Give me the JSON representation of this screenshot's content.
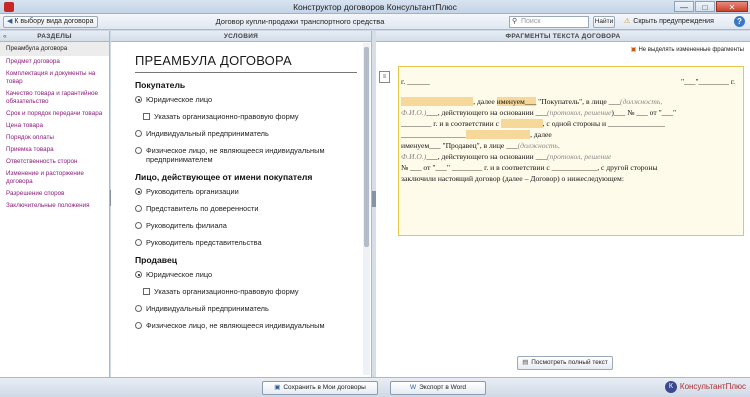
{
  "window": {
    "title": "Конструктор договоров КонсультантПлюс",
    "minimize": "—",
    "maximize": "□",
    "close": "✕"
  },
  "toolbar": {
    "back_label": "К выбору вида договора",
    "doc_title": "Договор купли-продажи транспортного средства",
    "search_placeholder": "Поиск",
    "find_label": "Найти",
    "hide_warnings_label": "Скрыть предупреждения",
    "help": "?"
  },
  "left_panel": {
    "header": "РАЗДЕЛЫ",
    "items": [
      "Преамбула договора",
      "Предмет договора",
      "Комплектация и документы на товар",
      "Качество товара и гарантийное обязательство",
      "Срок и порядок передачи товара",
      "Цена товара",
      "Порядок оплаты",
      "Приемка товара",
      "Ответственность сторон",
      "Изменение и расторжение договора",
      "Разрешение споров",
      "Заключительные положения"
    ]
  },
  "middle_panel": {
    "header": "УСЛОВИЯ",
    "heading": "ПРЕАМБУЛА ДОГОВОРА",
    "buyer_title": "Покупатель",
    "buyer_options": [
      "Юридическое лицо",
      "Указать организационно-правовую форму",
      "Индивидуальный предприниматель",
      "Физическое лицо, не являющееся индивидуальным предпринимателем"
    ],
    "buyer_rep_title": "Лицо, действующее от имени покупателя",
    "buyer_rep_options": [
      "Руководитель организации",
      "Представитель по доверенности",
      "Руководитель филиала",
      "Руководитель представительства"
    ],
    "seller_title": "Продавец",
    "seller_options": [
      "Юридическое лицо",
      "Указать организационно-правовую форму",
      "Индивидуальный предприниматель",
      "Физическое лицо, не являющееся индивидуальным"
    ]
  },
  "right_panel": {
    "header": "ФРАГМЕНТЫ ТЕКСТА ДОГОВОРА",
    "no_highlight_label": "Не выделять измененные фрагменты",
    "fragment": {
      "city": "г. ______",
      "date": "\"___\"________ г.",
      "l1_b": ", далее ",
      "l1_c": "именуем___",
      "l1_d": " \"Покупатель\", в лице ___",
      "l1_e": "(должность,",
      "l2_a": "Ф.И.О.)",
      "l2_b": "___, действующего на основании ___",
      "l2_c": "(протокол, решение",
      "l2_d": ")___ № ___ от \"___\"",
      "l3_a": "________ г. и в соответствии с ",
      "l3_c": ", с одной стороны и _______________",
      "l4_a": "_________________",
      "l4_b": ", далее",
      "l5_a": "именуем___ \"Продавец\", в лице ___",
      "l5_b": "(должность,",
      "l6_a": "Ф.И.О.)",
      "l6_b": "___, действующего на основании ___",
      "l6_c": "(протокол, решение",
      "l7_a": "№ ___ от \"___\" ________ г. и в соответствии с ____________, с другой стороны",
      "l8_a": "заключили настоящий договор (далее – Договор) о нижеследующем:"
    },
    "view_full_label": "Посмотреть полный текст"
  },
  "bottom": {
    "save_label": "Сохранить в Мои договоры",
    "export_label": "Экспорт в Word",
    "brand": "КонсультантПлюс"
  }
}
